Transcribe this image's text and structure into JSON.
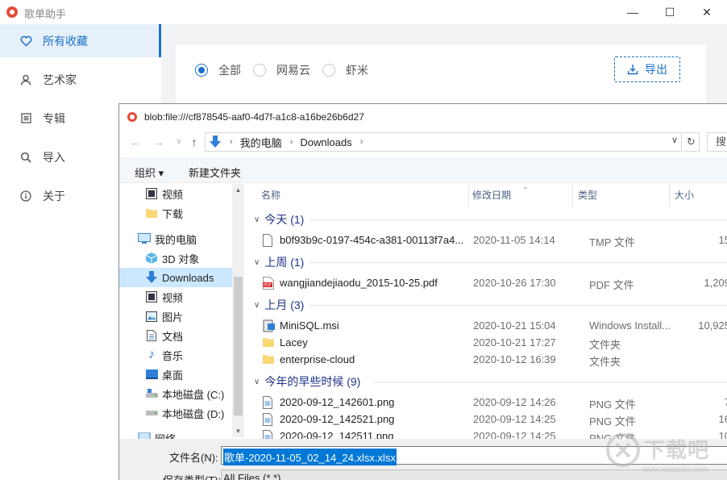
{
  "app": {
    "title": "歌单助手",
    "window_controls": {
      "minimize": "—",
      "maximize": "☐",
      "close": "✕"
    },
    "sidebar": {
      "items": [
        {
          "label": "所有收藏",
          "icon": "heart-icon",
          "active": true
        },
        {
          "label": "艺术家",
          "icon": "person-icon"
        },
        {
          "label": "专辑",
          "icon": "album-icon"
        },
        {
          "label": "导入",
          "icon": "search-icon"
        },
        {
          "label": "关于",
          "icon": "info-icon"
        }
      ]
    },
    "filter": {
      "options": [
        {
          "label": "全部",
          "selected": true
        },
        {
          "label": "网易云",
          "selected": false
        },
        {
          "label": "虾米",
          "selected": false
        }
      ],
      "export_label": "导出"
    },
    "accent_color": "#1a70c8"
  },
  "dialog": {
    "title": "blob:file:///cf878545-aaf0-4d7f-a1c8-a16be26b6d27",
    "breadcrumb": [
      "我的电脑",
      "Downloads"
    ],
    "search_placeholder": "搜",
    "commands": {
      "organize": "组织 ▾",
      "new_folder": "新建文件夹"
    },
    "nav_items": [
      {
        "label": "视频",
        "icon": "video-icon"
      },
      {
        "label": "下载",
        "icon": "folder-icon"
      },
      {
        "label": "我的电脑",
        "icon": "computer-icon"
      },
      {
        "label": "3D 对象",
        "icon": "3d-objects-icon"
      },
      {
        "label": "Downloads",
        "icon": "download-arrow-icon",
        "selected": true
      },
      {
        "label": "视频",
        "icon": "video-icon"
      },
      {
        "label": "图片",
        "icon": "picture-icon"
      },
      {
        "label": "文档",
        "icon": "document-icon"
      },
      {
        "label": "音乐",
        "icon": "music-icon"
      },
      {
        "label": "桌面",
        "icon": "desktop-icon"
      },
      {
        "label": "本地磁盘 (C:)",
        "icon": "drive-icon"
      },
      {
        "label": "本地磁盘 (D:)",
        "icon": "drive-icon"
      },
      {
        "label": "网络",
        "icon": "network-icon"
      }
    ],
    "columns": {
      "name": "名称",
      "date": "修改日期",
      "type": "类型",
      "size": "大小"
    },
    "groups": [
      {
        "label": "今天 (1)",
        "files": [
          {
            "name": "b0f93b9c-0197-454c-a381-00113f7a4...",
            "date": "2020-11-05 14:14",
            "type": "TMP 文件",
            "size": "15",
            "icon": "file-icon"
          }
        ]
      },
      {
        "label": "上周 (1)",
        "files": [
          {
            "name": "wangjiandejiaodu_2015-10-25.pdf",
            "date": "2020-10-26 17:30",
            "type": "PDF 文件",
            "size": "1,209",
            "icon": "pdf-icon"
          }
        ]
      },
      {
        "label": "上月 (3)",
        "files": [
          {
            "name": "MiniSQL.msi",
            "date": "2020-10-21 15:04",
            "type": "Windows Install...",
            "size": "10,925",
            "icon": "installer-icon"
          },
          {
            "name": "Lacey",
            "date": "2020-10-21 17:27",
            "type": "文件夹",
            "size": "",
            "icon": "folder-icon"
          },
          {
            "name": "enterprise-cloud",
            "date": "2020-10-12 16:39",
            "type": "文件夹",
            "size": "",
            "icon": "folder-icon"
          }
        ]
      },
      {
        "label": "今年的早些时候 (9)",
        "files": [
          {
            "name": "2020-09-12_142601.png",
            "date": "2020-09-12 14:26",
            "type": "PNG 文件",
            "size": "7",
            "icon": "image-file-icon"
          },
          {
            "name": "2020-09-12_142521.png",
            "date": "2020-09-12 14:25",
            "type": "PNG 文件",
            "size": "16",
            "icon": "image-file-icon"
          },
          {
            "name": "2020-09-12_142511.png",
            "date": "2020-09-12 14:25",
            "type": "PNG 文件",
            "size": "10",
            "icon": "image-file-icon"
          }
        ]
      }
    ],
    "filename_label": "文件名(N):",
    "filename_value": "歌单-2020-11-05_02_14_24.xlsx.xlsx",
    "filetype_label": "保存类型(T):",
    "filetype_value": "All Files (*.*)"
  },
  "watermark": {
    "text": "下载吧",
    "url": "www.xiazaiba.com"
  }
}
